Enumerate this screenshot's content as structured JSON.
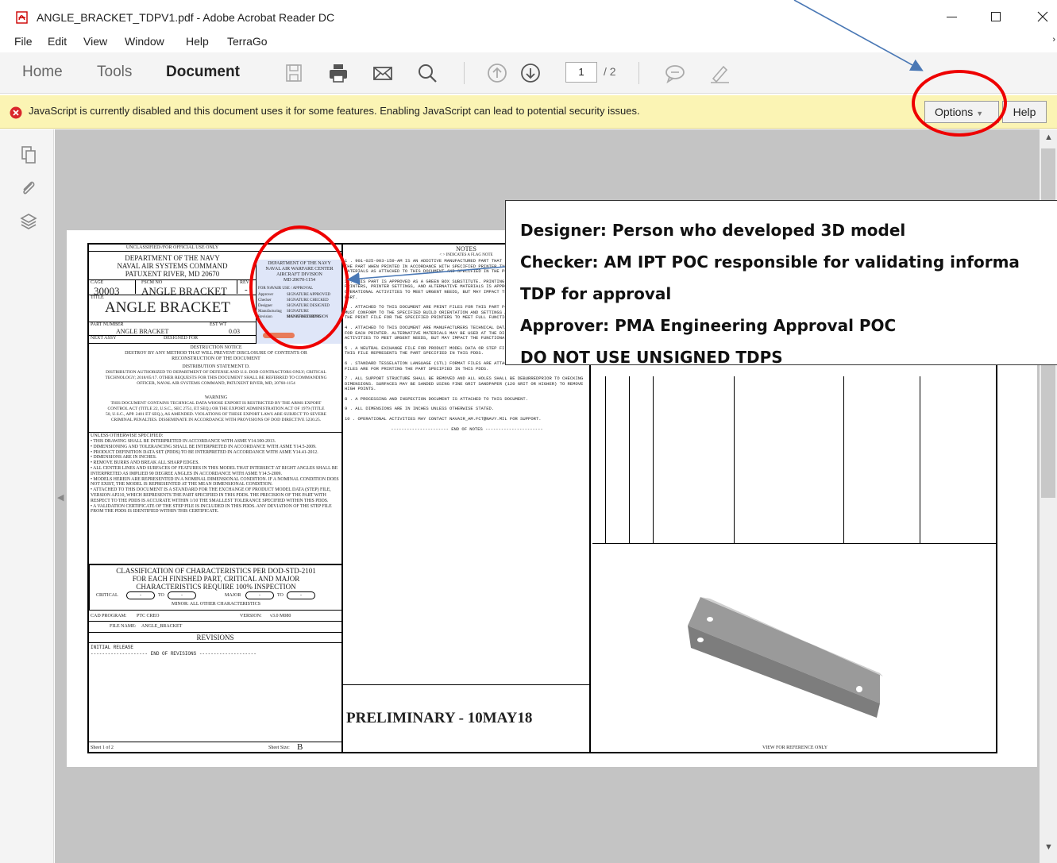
{
  "window": {
    "title": "ANGLE_BRACKET_TDPV1.pdf - Adobe Acrobat Reader DC",
    "controls": {
      "minimize": "—",
      "maximize": "☐",
      "close": "✕"
    }
  },
  "menu": {
    "items": [
      "File",
      "Edit",
      "View",
      "Window",
      "Help",
      "TerraGo"
    ]
  },
  "toolbar": {
    "tabs": [
      "Home",
      "Tools",
      "Document"
    ],
    "page_current": "1",
    "page_total": "/ 2"
  },
  "warning": {
    "text": "JavaScript is currently disabled and this document uses it for some features. Enabling JavaScript can lead to potential security issues.",
    "options_label": "Options",
    "help_label": "Help"
  },
  "callout": {
    "lines": [
      "Designer: Person who developed 3D model",
      "Checker: AM IPT POC responsible for validating informa",
      "TDP for approval",
      "Approver:  PMA Engineering Approval POC",
      "DO NOT USE UNSIGNED TDPS"
    ]
  },
  "drawing": {
    "top_banner": "UNCLASSIFIED//FOR OFFICIAL USE ONLY",
    "org": [
      "DEPARTMENT OF THE NAVY",
      "NAVAL AIR SYSTEMS COMMAND",
      "PATUXENT RIVER, MD 20670"
    ],
    "cage_label": "CAGE",
    "cage": "30003",
    "fsc_label": "FSCM NO",
    "title_small": "ANGLE BRACKET",
    "rev_label": "REV",
    "rev": "-",
    "title_label": "TITLE",
    "title_big": "ANGLE BRACKET",
    "part_number_label": "PART NUMBER",
    "part_number": "ANGLE BRACKET",
    "est_wt_label": "EST WT",
    "est_wt": "0.03",
    "next_assy": "NEXT ASSY",
    "designed_for": "DESIGNED FOR",
    "sig_header": [
      "DEPARTMENT OF THE NAVY",
      "NAVAL AIR WARFARE CENTER",
      "AIRCRAFT DIVISION",
      "MD 20670-1154"
    ],
    "sig_table_header": "FOR NAVAIR USE / APPROVAL",
    "sig_rows": [
      {
        "role": "Approver",
        "value": "SIGNATURE  APPROVED"
      },
      {
        "role": "Checker",
        "value": "SIGNATURE  CHECKED"
      },
      {
        "role": "Designer",
        "value": "SIGNATURE  DESIGNED"
      },
      {
        "role": "Manufacturing",
        "value": "SIGNATURE  MANUFACTURING"
      },
      {
        "role": "Revision",
        "value": "SIGNATURE  REVISION"
      }
    ],
    "destruction": "DESTRUCTION NOTICE",
    "destruction_text": "DESTROY BY ANY METHOD THAT WILL PREVENT DISCLOSURE OF CONTENTS OR RECONSTRUCTION OF THE DOCUMENT",
    "distribution": "DISTRIBUTION STATEMENT D.",
    "distribution_text": "DISTRIBUTION AUTHORIZED TO DEPARTMENT OF DEFENSE AND U.S. DOD CONTRACTORS ONLY; CRITICAL TECHNOLOGY; 2018/05/17. OTHER REQUESTS FOR THIS DOCUMENT SHALL BE REFERRED TO COMMANDING OFFICER, NAVAL AIR SYSTEMS COMMAND, PATUXENT RIVER, MD, 20760-1154",
    "warning_head": "WARNING",
    "warning_text": "THIS DOCUMENT CONTAINS TECHNICAL DATA WHOSE EXPORT IS RESTRICTED BY THE ARMS EXPORT CONTROL ACT (TITLE 22, U.S.C., SEC 2751, ET SEQ.) OR THE EXPORT ADMINISTRATION ACT OF 1979 (TITLE 50, U.S.C., APP. 2401 ET SEQ.), AS AMENDED. VIOLATIONS OF THESE EXPORT LAWS ARE SUBJECT TO SEVERE CRIMINAL PENALTIES. DISSEMINATE IN ACCORDANCE WITH PROVISIONS OF DOD DIRECTIVE 5230.25.",
    "unless": "UNLESS OTHERWISE SPECIFIED:",
    "unless_items": [
      "• THIS DRAWING SHALL BE INTERPRETED IN ACCORDANCE WITH ASME Y14.100-2013.",
      "• DIMENSIONING AND TOLERANCING SHALL BE INTERPRETED IN ACCORDANCE WITH ASME Y14.5-2009.",
      "• PRODUCT DEFINITION DATA SET (PDDS) TO BE INTERPRETED IN ACCORDANCE WITH ASME Y14.41-2012.",
      "• DIMENSIONS ARE IN INCHES.",
      "• REMOVE BURRS AND BREAK ALL SHARP EDGES.",
      "• ALL CENTER LINES AND SURFACES OF FEATURES IN THIS MODEL THAT INTERSECT AT RIGHT ANGLES SHALL BE INTERPRETED AS IMPLIED 90 DEGREE ANGLES IN ACCORDANCE WITH ASME Y14.5-2009.",
      "• MODELS HEREIN ARE REPRESENTED IN A NOMINAL DIMENSIONAL CONDITION. IF A NOMINAL CONDITION DOES NOT EXIST, THE MODEL IS REPRESENTED AT THE MEAN DIMENSIONAL CONDITION.",
      "• ATTACHED TO THIS DOCUMENT IS A STANDARD FOR THE EXCHANGE OF PRODUCT MODEL DATA (STEP) FILE, VERSION AP210, WHICH REPRESENTS THE PART SPECIFIED IN THIS PDDS. THE PRECISION OF THE PART WITH RESPECT TO THE PDDS IS ACCURATE WITHIN 1/10 THE SMALLEST TOLERANCE SPECIFIED WITHIN THIS PDDS.",
      "• A VALIDATION CERTIFICATE OF THE STEP FILE IS INCLUDED IN THIS PDDS. ANY DEVIATION OF THE STEP FILE FROM THE PDDS IS IDENTIFIED WITHIN THIS CERTIFICATE."
    ],
    "classification": [
      "CLASSIFICATION OF CHARACTERISTICS PER DOD-STD-2101",
      "FOR EACH FINISHED PART, CRITICAL AND MAJOR",
      "CHARACTERISTICS REQUIRE 100% INSPECTION"
    ],
    "critical_label": "CRITICAL",
    "major_label": "MAJOR",
    "to_label": "TO",
    "dash": "-",
    "minor_text": "MINOR: ALL OTHER CHARACTERISTICS",
    "cad_label": "CAD PROGRAM:",
    "cad": "PTC CREO",
    "version_label": "VERSION:",
    "version": "v3.0 M080",
    "file_label": "FILE NAME:",
    "file": "ANGLE_BRACKET",
    "revisions_head": "REVISIONS",
    "initial_release": "INITIAL RELEASE",
    "end_revisions": "-------------------- END OF REVISIONS --------------------",
    "sheet": "Sheet 1 of 2",
    "sheet_size_label": "Sheet Size:",
    "sheet_size": "B",
    "notes_head": "NOTES",
    "notes_sub": "< > INDICATES A FLAG NOTE",
    "notes": [
      "1 . 901-025-903-159-AM IS AN ADDITIVE MANUFACTURED PART THAT IS APPROVED AS AN ALTERNATIVE TO THE PART WHEN PRINTED IN ACCORDANCE WITH SPECIFIED PRINTER TYPES, PRINTER SETTINGS, AND MATERIALS AS ATTACHED TO THIS DOCUMENT AND SPECIFIED IN THE PDDS.",
      "2 . THIS PART IS APPROVED AS A GREEN BOX SUBSTITUTE. PRINTING THIS PART WITH NON-SPECIFIED PRINTERS, PRINTER SETTINGS, AND ALTERNATIVE MATERIALS IS APPROVED AT THE DISCRETION OF OPERATIONAL ACTIVITIES TO MEET URGENT NEEDS, BUT MAY IMPACT THE FUNCTIONAL PERFORMANCE OF THE PART.",
      "3 . ATTACHED TO THIS DOCUMENT ARE PRINT FILES FOR THIS PART FOR MULTIPLE PRINTERS. THE USER MUST CONFORM TO THE SPECIFIED BUILD ORIENTATION AND SETTINGS AS DESCRIBED IN THE PDDS. USE THE PRINT FILE FOR THE SPECIFIED PRINTERS TO MEET FULL FUNCTIONAL PERFORMANCE.",
      "4 . ATTACHED TO THIS DOCUMENT ARE MANUFACTURERS TECHNICAL DATA SHEETS FOR SPECIFIED MATERIALS FOR EACH PRINTER. ALTERNATIVE MATERIALS MAY BE USED AT THE DISCRETION OF OPERATIONAL ACTIVITIES TO MEET URGENT NEEDS, BUT MAY IMPACT THE FUNCTIONAL PERFORMANCE OF THE PART.",
      "5 . A NEUTRAL EXCHANGE FILE FOR PRODUCT MODEL DATA OR STEP FILE IS ATTACHED TO THIS DOCUMENT. THIS FILE REPRESENTS THE PART SPECIFIED IN THIS PDDS.",
      "6 . STANDARD TESSELATION LANGUAGE (STL) FORMAT FILES ARE ATTACHED TO THIS DOCUMENT. THESE FILES ARE FOR PRINTING THE PART SPECIFIED IN THIS PDDS.",
      "7 . ALL SUPPORT STRUCTURE SHALL BE REMOVED AND ALL HOLES SHALL BE DEBURREDPRIOR TO CHECKING DIMENSIONS. SURFACES MAY BE SANDED USING FINE GRIT SANDPAPER (120 GRIT OR HIGHER) TO REMOVE HIGH POINTS.",
      "8 . A PROCESSING AND INSPECTION DOCUMENT IS ATTACHED TO THIS DOCUMENT.",
      "9 . ALL DIMENSIONS ARE IN INCHES UNLESS OTHERWISE STATED.",
      "10 . OPERATIONAL ACTIVITIES MAY CONTACT NAVAIR_AM.FCT@NAVY.MIL FOR SUPPORT."
    ],
    "end_notes": "---------------------- END OF NOTES ----------------------",
    "preliminary": "PRELIMINARY - 10MAY18",
    "view_ref": "VIEW FOR REFERENCE ONLY"
  },
  "colors": {
    "warn_bg": "#fbf4b4",
    "sig_bg": "#dfe6f8",
    "annotation_red": "#e00000",
    "arrow_blue": "#4a78b5"
  }
}
